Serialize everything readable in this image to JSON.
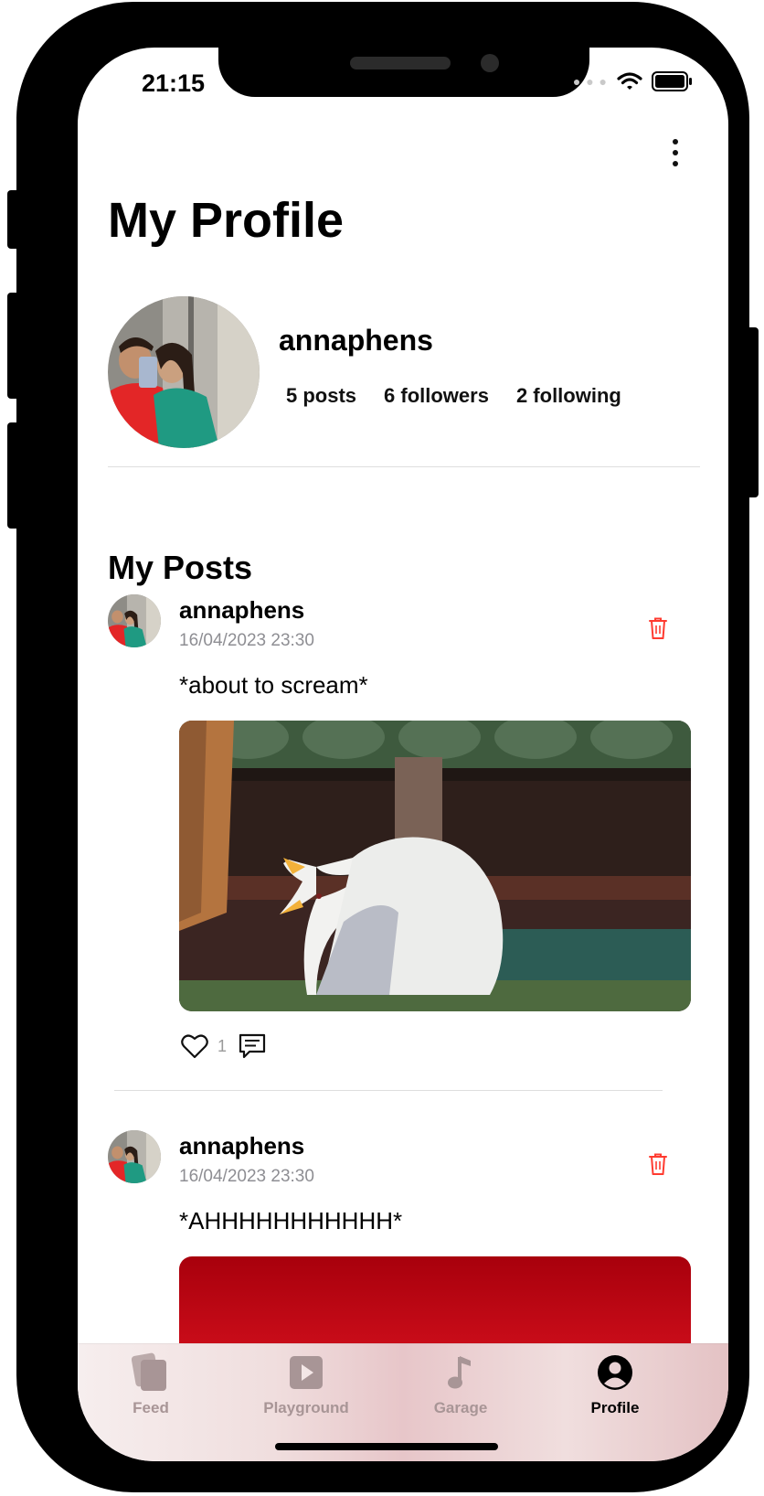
{
  "status_bar": {
    "time": "21:15"
  },
  "header": {
    "title": "My Profile"
  },
  "profile": {
    "username": "annaphens",
    "posts_label": "5 posts",
    "followers_label": "6 followers",
    "following_label": "2 following"
  },
  "section": {
    "title": "My Posts"
  },
  "posts": [
    {
      "username": "annaphens",
      "date": "16/04/2023 23:30",
      "text": "*about to scream*",
      "likes": "1"
    },
    {
      "username": "annaphens",
      "date": "16/04/2023 23:30",
      "text": "*AHHHHHHHHHHH*"
    }
  ],
  "tabs": [
    {
      "label": "Feed",
      "icon": "feed-icon"
    },
    {
      "label": "Playground",
      "icon": "play-icon"
    },
    {
      "label": "Garage",
      "icon": "music-note-icon"
    },
    {
      "label": "Profile",
      "icon": "person-circle-icon",
      "active": true
    }
  ],
  "colors": {
    "delete": "#ff3b30",
    "tab_inactive": "#a89596",
    "tab_active": "#000000"
  }
}
